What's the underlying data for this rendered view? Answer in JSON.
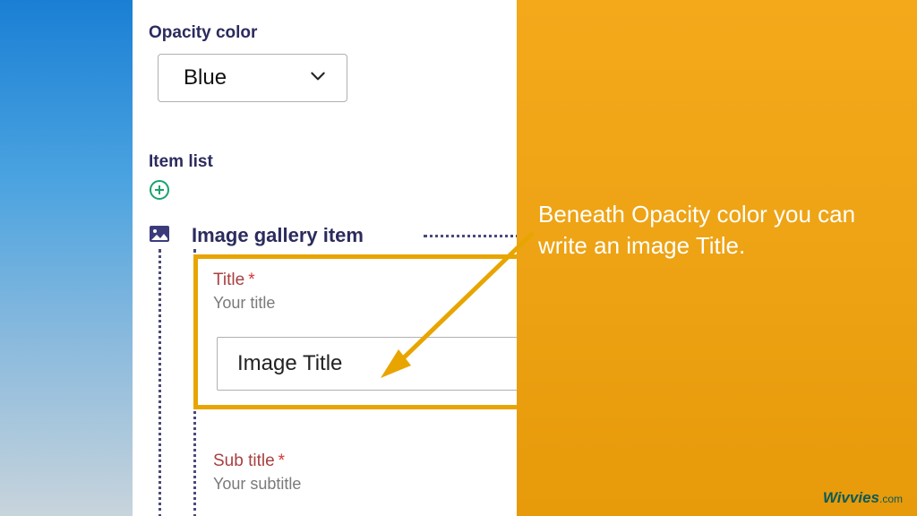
{
  "form": {
    "opacity": {
      "label": "Opacity color",
      "value": "Blue"
    },
    "itemList": {
      "label": "Item list"
    },
    "galleryItem": {
      "heading": "Image gallery item",
      "title": {
        "label": "Title",
        "required": "*",
        "help": "Your title",
        "value": "Image Title"
      },
      "subtitle": {
        "label": "Sub title",
        "required": "*",
        "help": "Your subtitle"
      }
    }
  },
  "annotation": {
    "text": "Beneath Opacity color you can write an image Title."
  },
  "brand": {
    "name": "Wivvies",
    "suffix": ".com"
  },
  "colors": {
    "highlight": "#e8a500",
    "panel": "#f3a91a",
    "heading": "#2b2b5e"
  }
}
